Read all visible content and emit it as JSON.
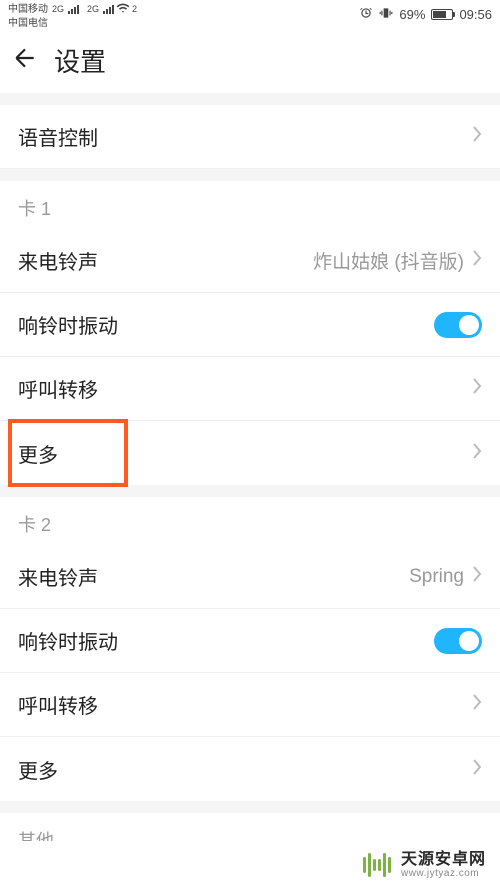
{
  "status": {
    "carrier1": "中国移动",
    "carrier2": "中国电信",
    "net": "2G",
    "sim2": "2",
    "battery_pct": "69%",
    "time": "09:56"
  },
  "header": {
    "title": "设置"
  },
  "rows": {
    "voice_control": "语音控制"
  },
  "sim1": {
    "header": "卡 1",
    "ringtone_label": "来电铃声",
    "ringtone_value": "炸山姑娘 (抖音版)",
    "vibrate_label": "响铃时振动",
    "vibrate_on": true,
    "forward_label": "呼叫转移",
    "more_label": "更多"
  },
  "sim2": {
    "header": "卡 2",
    "ringtone_label": "来电铃声",
    "ringtone_value": "Spring",
    "vibrate_label": "响铃时振动",
    "vibrate_on": true,
    "forward_label": "呼叫转移",
    "more_label": "更多"
  },
  "other": {
    "header": "其他"
  },
  "footer": {
    "cn": "天源安卓网",
    "en": "www.jytyaz.com"
  }
}
